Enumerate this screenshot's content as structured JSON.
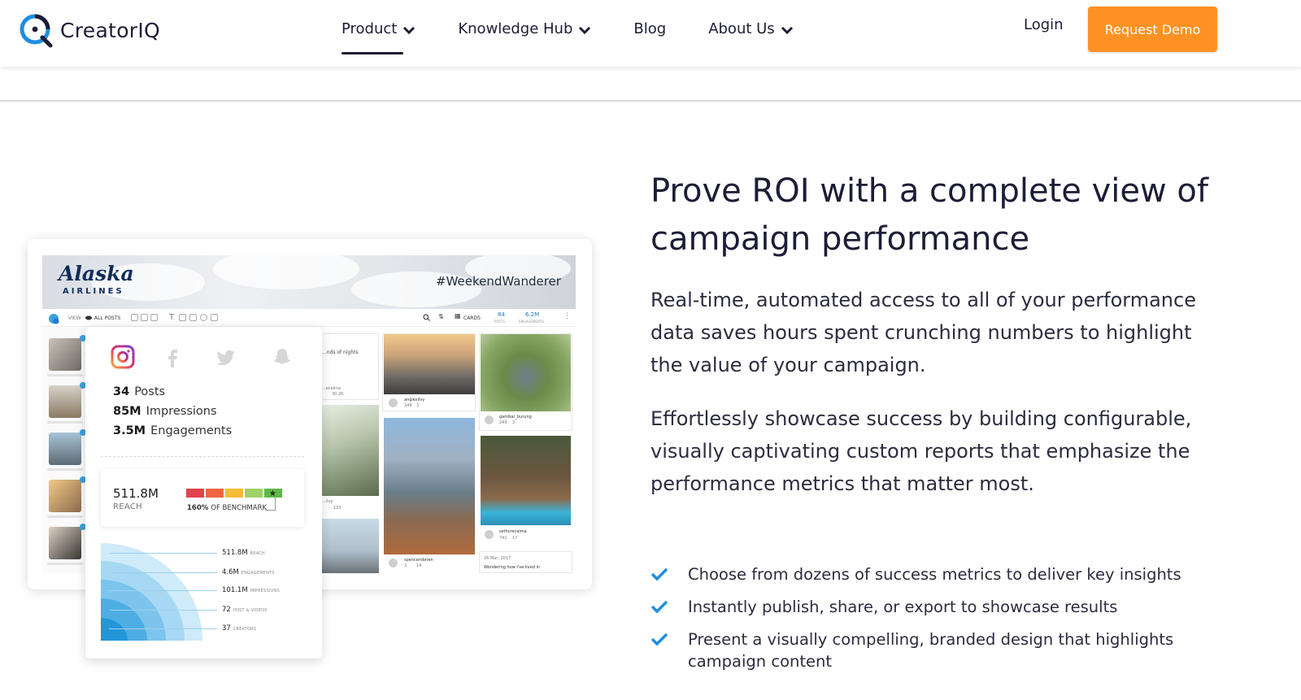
{
  "brand": {
    "name": "CreatorIQ",
    "accent": "#ff9223",
    "navy": "#1d1d36",
    "logo_blue": "#1f8ee0"
  },
  "nav": {
    "items": [
      {
        "label": "Product",
        "has_dropdown": true,
        "active": true
      },
      {
        "label": "Knowledge Hub",
        "has_dropdown": true,
        "active": false
      },
      {
        "label": "Blog",
        "has_dropdown": false,
        "active": false
      },
      {
        "label": "About Us",
        "has_dropdown": true,
        "active": false
      }
    ],
    "login_label": "Login",
    "demo_label": "Request Demo"
  },
  "hero": {
    "headline": "Prove ROI with a complete view of campaign performance",
    "paragraph_1": "Real-time, automated access to all of your performance data saves hours spent crunching numbers to highlight the value of your campaign.",
    "paragraph_2": "Effortlessly showcase success by building configurable, visually captivating custom reports that emphasize the performance metrics that matter most.",
    "bullets": [
      "Choose from dozens of success metrics to deliver key insights",
      "Instantly publish, share, or export to showcase results",
      "Present a visually compelling, branded design that highlights campaign content"
    ],
    "check_color": "#1f8ee0"
  },
  "mockup": {
    "brand_name": "Alaska",
    "brand_sub": "AIRLINES",
    "hashtag": "#WeekendWanderer",
    "toolbar": {
      "view_label": "VIEW",
      "filter_label": "ALL POSTS",
      "layout_label": "CARDS",
      "posts_value": "84",
      "posts_label": "POSTS",
      "engagements_value": "6.2M",
      "engagements_label": "ENGAGEMENTS"
    },
    "stats": [
      {
        "value": "34",
        "label": "Posts"
      },
      {
        "value": "85M",
        "label": "Impressions"
      },
      {
        "value": "3.5M",
        "label": "Engagements"
      }
    ],
    "reach": {
      "value": "511.8M",
      "label": "REACH"
    },
    "benchmark": {
      "value": "160%",
      "label": "OF BENCHMARK",
      "segment_colors": [
        "#e2424b",
        "#ef6542",
        "#f5bd38",
        "#9fd26a",
        "#5fb848"
      ]
    },
    "fan_metrics": [
      {
        "value": "511.8M",
        "label": "REACH"
      },
      {
        "value": "4.6M",
        "label": "ENGAGEMENTS"
      },
      {
        "value": "101.1M",
        "label": "IMPRESSIONS"
      },
      {
        "value": "72",
        "label": "POST & VIDEOS"
      },
      {
        "value": "37",
        "label": "CREATORS"
      }
    ],
    "posts": [
      {
        "caption": "...nds of nights",
        "handle": "...ecalma",
        "count": "30.2K"
      },
      {
        "handle": "angiesilvy",
        "likes": "249",
        "comments": "3"
      },
      {
        "handle": "gambar_burung",
        "likes": "249",
        "comments": "3"
      },
      {
        "handle": "...ilvy",
        "comments": "133"
      },
      {
        "handle": "spencerobrien",
        "likes": "3",
        "comments": "14"
      },
      {
        "handle": "sethcrecalma",
        "likes": "741",
        "comments": "17"
      },
      {
        "date": "26 Mar, 2017",
        "caption": "Wondering how I've lived in"
      }
    ]
  }
}
